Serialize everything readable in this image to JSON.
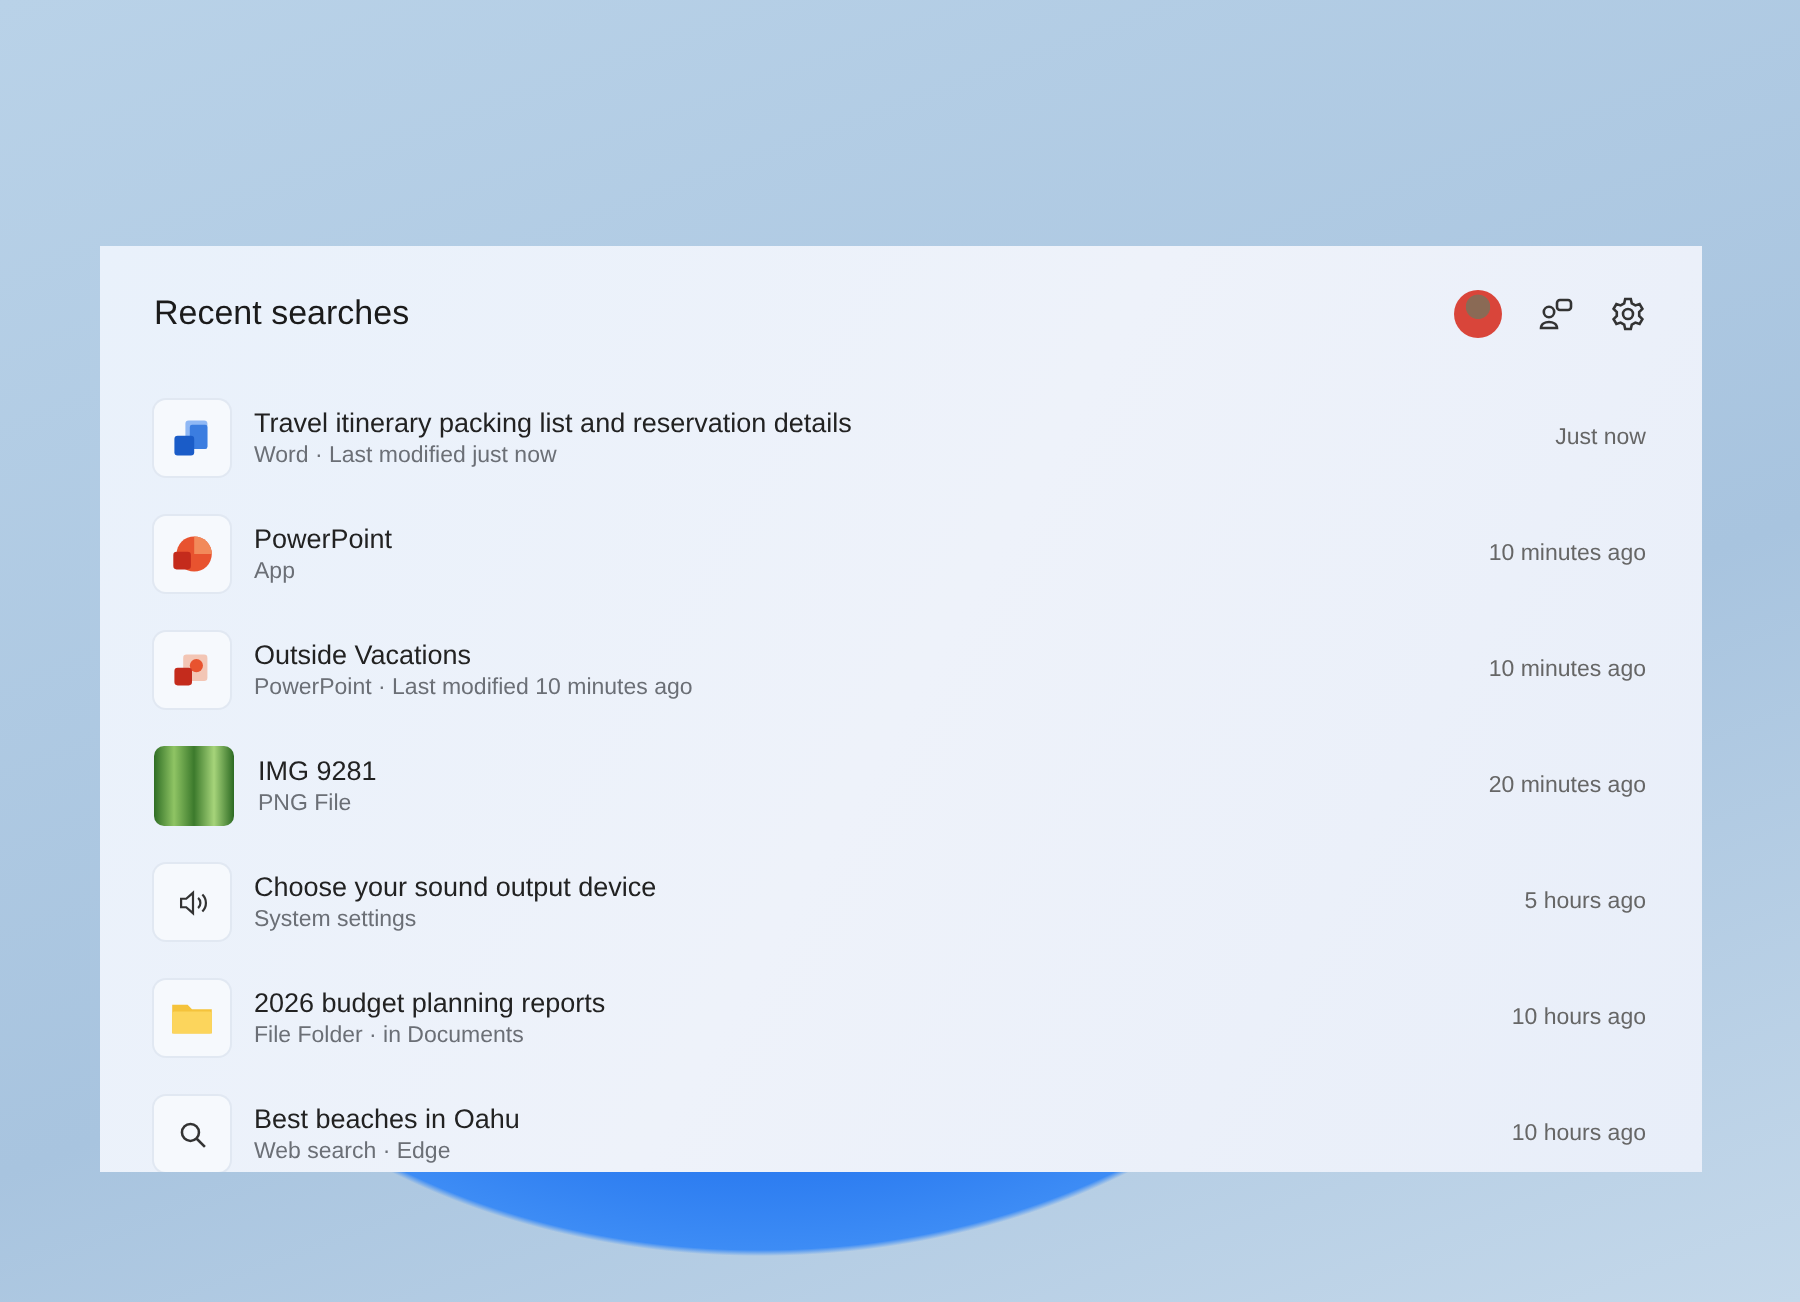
{
  "panel": {
    "title": "Recent searches"
  },
  "results": [
    {
      "kind": "word",
      "title": "Travel itinerary packing list and reservation details",
      "subtitle": "Word · Last modified just now",
      "time": "Just now"
    },
    {
      "kind": "powerpoint-app",
      "title": "PowerPoint",
      "subtitle": "App",
      "time": "10 minutes ago"
    },
    {
      "kind": "powerpoint-file",
      "title": "Outside Vacations",
      "subtitle": "PowerPoint · Last modified 10 minutes ago",
      "time": "10 minutes ago"
    },
    {
      "kind": "image",
      "title": "IMG 9281",
      "subtitle": "PNG File",
      "time": "20 minutes ago"
    },
    {
      "kind": "sound",
      "title": "Choose your sound output device",
      "subtitle": "System settings",
      "time": "5 hours ago"
    },
    {
      "kind": "folder",
      "title": "2026 budget planning reports",
      "subtitle": "File Folder · in Documents",
      "time": "10 hours ago"
    },
    {
      "kind": "search",
      "title": "Best beaches in Oahu",
      "subtitle": "Web search · Edge",
      "time": "10 hours ago"
    }
  ]
}
